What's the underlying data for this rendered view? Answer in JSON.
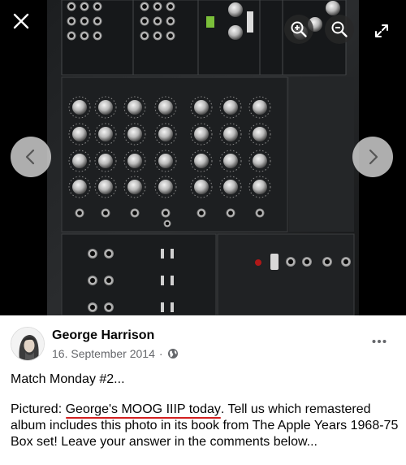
{
  "viewer": {
    "icons": {
      "close": "close-icon",
      "zoom_in": "zoom-in-icon",
      "zoom_out": "zoom-out-icon",
      "fullscreen": "expand-icon",
      "previous": "chevron-left-icon",
      "next": "chevron-right-icon"
    }
  },
  "post": {
    "author": "George Harrison",
    "date": "16. September 2014",
    "separator": "·",
    "audience_icon": "globe-icon",
    "first_line": "Match Monday #2...",
    "text": {
      "label": "Pictured: ",
      "highlight": "George's MOOG IIIP today",
      "rest": ". Tell us which remastered album includes this photo in its book from The Apple Years 1968-75 Box set! Leave your answer in the comments below..."
    }
  },
  "colors": {
    "underline": "#d21f1f",
    "meta_text": "#65676b"
  }
}
